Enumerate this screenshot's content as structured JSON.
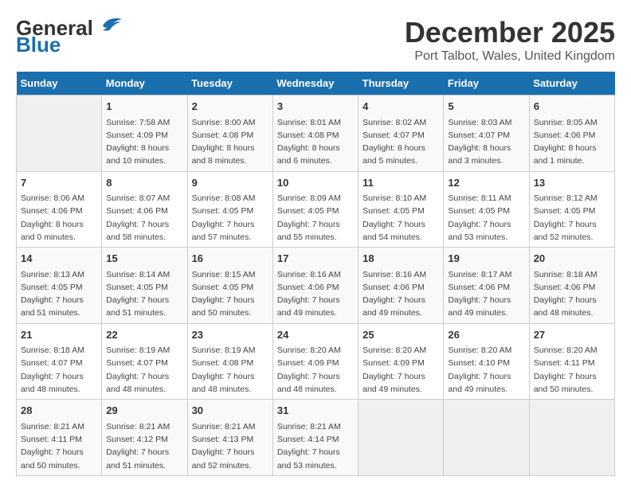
{
  "logo": {
    "line1": "General",
    "line2": "Blue"
  },
  "title": "December 2025",
  "subtitle": "Port Talbot, Wales, United Kingdom",
  "days_header": [
    "Sunday",
    "Monday",
    "Tuesday",
    "Wednesday",
    "Thursday",
    "Friday",
    "Saturday"
  ],
  "weeks": [
    [
      {
        "day": "",
        "info": ""
      },
      {
        "day": "1",
        "info": "Sunrise: 7:58 AM\nSunset: 4:09 PM\nDaylight: 8 hours\nand 10 minutes."
      },
      {
        "day": "2",
        "info": "Sunrise: 8:00 AM\nSunset: 4:08 PM\nDaylight: 8 hours\nand 8 minutes."
      },
      {
        "day": "3",
        "info": "Sunrise: 8:01 AM\nSunset: 4:08 PM\nDaylight: 8 hours\nand 6 minutes."
      },
      {
        "day": "4",
        "info": "Sunrise: 8:02 AM\nSunset: 4:07 PM\nDaylight: 8 hours\nand 5 minutes."
      },
      {
        "day": "5",
        "info": "Sunrise: 8:03 AM\nSunset: 4:07 PM\nDaylight: 8 hours\nand 3 minutes."
      },
      {
        "day": "6",
        "info": "Sunrise: 8:05 AM\nSunset: 4:06 PM\nDaylight: 8 hours\nand 1 minute."
      }
    ],
    [
      {
        "day": "7",
        "info": "Sunrise: 8:06 AM\nSunset: 4:06 PM\nDaylight: 8 hours\nand 0 minutes."
      },
      {
        "day": "8",
        "info": "Sunrise: 8:07 AM\nSunset: 4:06 PM\nDaylight: 7 hours\nand 58 minutes."
      },
      {
        "day": "9",
        "info": "Sunrise: 8:08 AM\nSunset: 4:05 PM\nDaylight: 7 hours\nand 57 minutes."
      },
      {
        "day": "10",
        "info": "Sunrise: 8:09 AM\nSunset: 4:05 PM\nDaylight: 7 hours\nand 55 minutes."
      },
      {
        "day": "11",
        "info": "Sunrise: 8:10 AM\nSunset: 4:05 PM\nDaylight: 7 hours\nand 54 minutes."
      },
      {
        "day": "12",
        "info": "Sunrise: 8:11 AM\nSunset: 4:05 PM\nDaylight: 7 hours\nand 53 minutes."
      },
      {
        "day": "13",
        "info": "Sunrise: 8:12 AM\nSunset: 4:05 PM\nDaylight: 7 hours\nand 52 minutes."
      }
    ],
    [
      {
        "day": "14",
        "info": "Sunrise: 8:13 AM\nSunset: 4:05 PM\nDaylight: 7 hours\nand 51 minutes."
      },
      {
        "day": "15",
        "info": "Sunrise: 8:14 AM\nSunset: 4:05 PM\nDaylight: 7 hours\nand 51 minutes."
      },
      {
        "day": "16",
        "info": "Sunrise: 8:15 AM\nSunset: 4:05 PM\nDaylight: 7 hours\nand 50 minutes."
      },
      {
        "day": "17",
        "info": "Sunrise: 8:16 AM\nSunset: 4:06 PM\nDaylight: 7 hours\nand 49 minutes."
      },
      {
        "day": "18",
        "info": "Sunrise: 8:16 AM\nSunset: 4:06 PM\nDaylight: 7 hours\nand 49 minutes."
      },
      {
        "day": "19",
        "info": "Sunrise: 8:17 AM\nSunset: 4:06 PM\nDaylight: 7 hours\nand 49 minutes."
      },
      {
        "day": "20",
        "info": "Sunrise: 8:18 AM\nSunset: 4:06 PM\nDaylight: 7 hours\nand 48 minutes."
      }
    ],
    [
      {
        "day": "21",
        "info": "Sunrise: 8:18 AM\nSunset: 4:07 PM\nDaylight: 7 hours\nand 48 minutes."
      },
      {
        "day": "22",
        "info": "Sunrise: 8:19 AM\nSunset: 4:07 PM\nDaylight: 7 hours\nand 48 minutes."
      },
      {
        "day": "23",
        "info": "Sunrise: 8:19 AM\nSunset: 4:08 PM\nDaylight: 7 hours\nand 48 minutes."
      },
      {
        "day": "24",
        "info": "Sunrise: 8:20 AM\nSunset: 4:09 PM\nDaylight: 7 hours\nand 48 minutes."
      },
      {
        "day": "25",
        "info": "Sunrise: 8:20 AM\nSunset: 4:09 PM\nDaylight: 7 hours\nand 49 minutes."
      },
      {
        "day": "26",
        "info": "Sunrise: 8:20 AM\nSunset: 4:10 PM\nDaylight: 7 hours\nand 49 minutes."
      },
      {
        "day": "27",
        "info": "Sunrise: 8:20 AM\nSunset: 4:11 PM\nDaylight: 7 hours\nand 50 minutes."
      }
    ],
    [
      {
        "day": "28",
        "info": "Sunrise: 8:21 AM\nSunset: 4:11 PM\nDaylight: 7 hours\nand 50 minutes."
      },
      {
        "day": "29",
        "info": "Sunrise: 8:21 AM\nSunset: 4:12 PM\nDaylight: 7 hours\nand 51 minutes."
      },
      {
        "day": "30",
        "info": "Sunrise: 8:21 AM\nSunset: 4:13 PM\nDaylight: 7 hours\nand 52 minutes."
      },
      {
        "day": "31",
        "info": "Sunrise: 8:21 AM\nSunset: 4:14 PM\nDaylight: 7 hours\nand 53 minutes."
      },
      {
        "day": "",
        "info": ""
      },
      {
        "day": "",
        "info": ""
      },
      {
        "day": "",
        "info": ""
      }
    ]
  ]
}
